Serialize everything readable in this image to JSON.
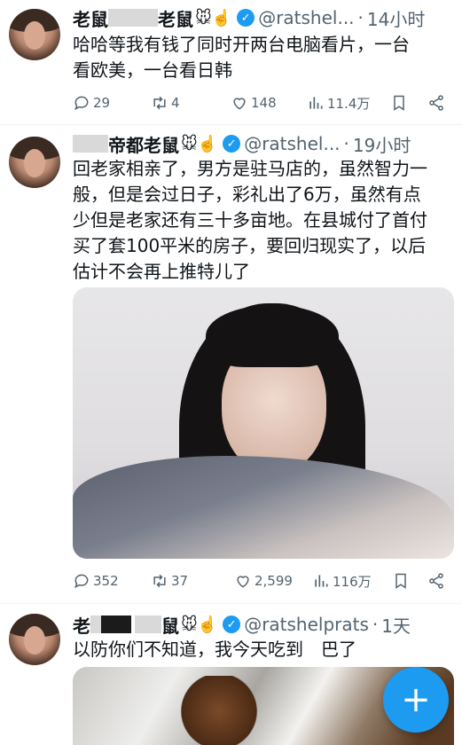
{
  "tweets": [
    {
      "name_prefix": "老鼠",
      "name_suffix": "老鼠",
      "emoji": "🐭☝️",
      "handle": "@ratshel...",
      "time": "14小时",
      "lines": [
        "哈哈等我有钱了同时开两台电脑看片，一台",
        "看欧美，一台看日韩"
      ],
      "replies": "29",
      "retweets": "4",
      "likes": "148",
      "views": "11.4万"
    },
    {
      "name_prefix": "",
      "name_suffix": "帝都老鼠",
      "emoji": "🐭☝️",
      "handle": "@ratshel...",
      "time": "19小时",
      "lines": [
        "回老家相亲了，男方是驻马店的，虽然智力一",
        "般，但是会过日子，彩礼出了6万，虽然有点",
        "少但是老家还有三十多亩地。在县城付了首付",
        "买了套100平米的房子，要回归现实了，以后",
        "估计不会再上推特儿了"
      ],
      "replies": "352",
      "retweets": "37",
      "likes": "2,599",
      "views": "116万"
    },
    {
      "name_prefix": "老",
      "name_suffix": "鼠",
      "emoji": "🐭☝️",
      "handle": "@ratshelprats",
      "time": "1天",
      "lines": [
        "以防你们不知道，我今天吃到　巴了"
      ]
    }
  ],
  "icons": {
    "reply": "reply-icon",
    "retweet": "retweet-icon",
    "like": "heart-icon",
    "views": "views-icon",
    "bookmark": "bookmark-icon",
    "share": "share-icon",
    "verified": "verified-icon",
    "compose": "compose-plus-icon"
  },
  "fab_label": "+",
  "colors": {
    "accent": "#1d9bf0",
    "muted": "#536471",
    "text": "#0f1419"
  }
}
